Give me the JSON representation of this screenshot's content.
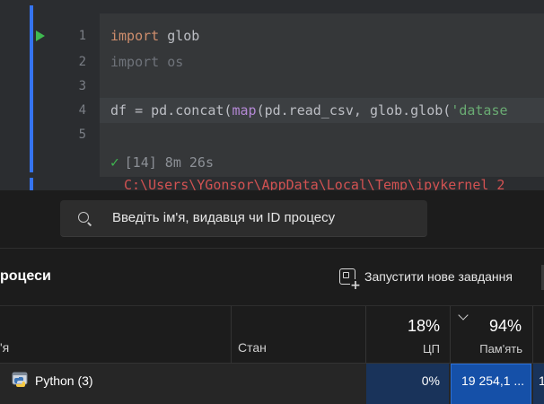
{
  "editor": {
    "line_numbers": [
      "1",
      "2",
      "3",
      "4",
      "5"
    ],
    "line1": {
      "kw": "import",
      "rest": " glob"
    },
    "line2": "import os",
    "line4": {
      "a": "df = pd.concat(",
      "fn": "map",
      "b": "(pd.read_csv, glob.glob(",
      "str": "'datase"
    },
    "exec_status": "[14] 8m 26s",
    "error_line": "C:\\Users\\YGonsor\\AppData\\Local\\Temp\\ipykernel_2"
  },
  "task_manager": {
    "search": {
      "placeholder": "Введіть ім'я, видавця чи ID процесу"
    },
    "section_title": "роцеси",
    "new_task_label": "Запустити нове завдання",
    "headers": {
      "name": "'я",
      "status": "Стан",
      "cpu_percent": "18%",
      "cpu_label": "ЦП",
      "memory_percent": "94%",
      "memory_label": "Пам'ять"
    },
    "rows": [
      {
        "name": "Python (3)",
        "status": "",
        "cpu": "0%",
        "memory": "19 254,1 ...",
        "next": "1"
      }
    ],
    "colors": {
      "accent": "#1550a8",
      "cpu_heat": "#19335a"
    }
  }
}
